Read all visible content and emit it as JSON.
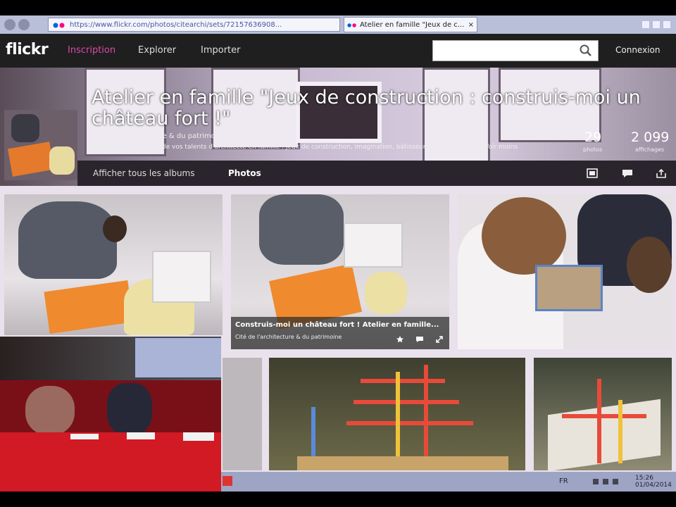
{
  "browser": {
    "url": "https://www.flickr.com/photos/citearchi/sets/72157636908...",
    "tab_title": "Atelier en famille \"Jeux de c...",
    "tab_close": "×"
  },
  "header": {
    "logo": "flickr",
    "nav": [
      {
        "label": "Inscription"
      },
      {
        "label": "Explorer"
      },
      {
        "label": "Importer"
      }
    ],
    "search_placeholder": "",
    "signin": "Connexion"
  },
  "album": {
    "title": "Atelier en famille \"Jeux de construction : construis-moi un château fort !\"",
    "owner": "Cité de l'architecture & du patrimoine",
    "description": "Partez à la recherche de vos talents d'architecte en famille : jeux de construction, imagination, bâtisseurs, sur les pas des...",
    "see_more": "Voir moins",
    "photo_count": "29",
    "photo_label": "photos",
    "view_count": "2 099",
    "view_label": "affichages",
    "links": {
      "albums": "Afficher tous les albums",
      "photos": "Photos"
    }
  },
  "hovered_photo": {
    "title": "Construis-moi un château fort ! Atelier en famille...",
    "owner": "Cité de l'architecture & du patrimoine"
  },
  "taskbar": {
    "lang": "FR",
    "time": "15:26",
    "date": "01/04/2014"
  },
  "colors": {
    "flickr_pink": "#d84aa8",
    "header_bg": "#1f1f1f",
    "grid_bg": "#e9e1ec"
  },
  "icons": [
    "search-icon",
    "slideshow-icon",
    "comment-icon",
    "share-icon",
    "star-icon",
    "expand-icon"
  ]
}
